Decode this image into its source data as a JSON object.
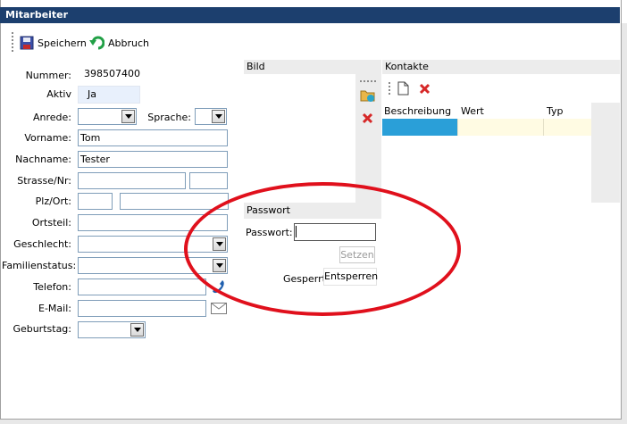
{
  "window": {
    "title": "Mitarbeiter"
  },
  "toolbar": {
    "save_label": "Speichern",
    "cancel_label": "Abbruch"
  },
  "form": {
    "number_label": "Nummer:",
    "number_value": "398507400",
    "active_label": "Aktiv",
    "active_value": "Ja",
    "salutation_label": "Anrede:",
    "salutation_value": "",
    "language_label": "Sprache:",
    "language_value": "",
    "firstname_label": "Vorname:",
    "firstname_value": "Tom",
    "lastname_label": "Nachname:",
    "lastname_value": "Tester",
    "street_label": "Strasse/Nr:",
    "street_value": "",
    "streetno_value": "",
    "zip_label": "Plz/Ort:",
    "zip_value": "",
    "city_value": "",
    "district_label": "Ortsteil:",
    "district_value": "",
    "gender_label": "Geschlecht:",
    "gender_value": "",
    "marital_label": "Familienstatus:",
    "marital_value": "",
    "phone_label": "Telefon:",
    "phone_value": "",
    "email_label": "E-Mail:",
    "email_value": "",
    "birthday_label": "Geburtstag:",
    "birthday_value": ""
  },
  "image_panel": {
    "title": "Bild"
  },
  "contacts": {
    "title": "Kontakte",
    "columns": [
      "Beschreibung",
      "Wert",
      "Typ"
    ]
  },
  "password": {
    "title": "Passwort",
    "label": "Passwort:",
    "value": "",
    "set_label": "Setzen",
    "locked_label": "Gesperrt",
    "unlock_label": "Entsperren"
  },
  "colors": {
    "titlebar": "#1c3f6e",
    "selection": "#2a9fd8",
    "highlight_ring": "#e0101c",
    "active_field": "#e8f0fc"
  },
  "icons": [
    "save-icon",
    "undo-icon",
    "folder-image-icon",
    "delete-icon",
    "new-document-icon",
    "phone-icon",
    "envelope-icon"
  ]
}
